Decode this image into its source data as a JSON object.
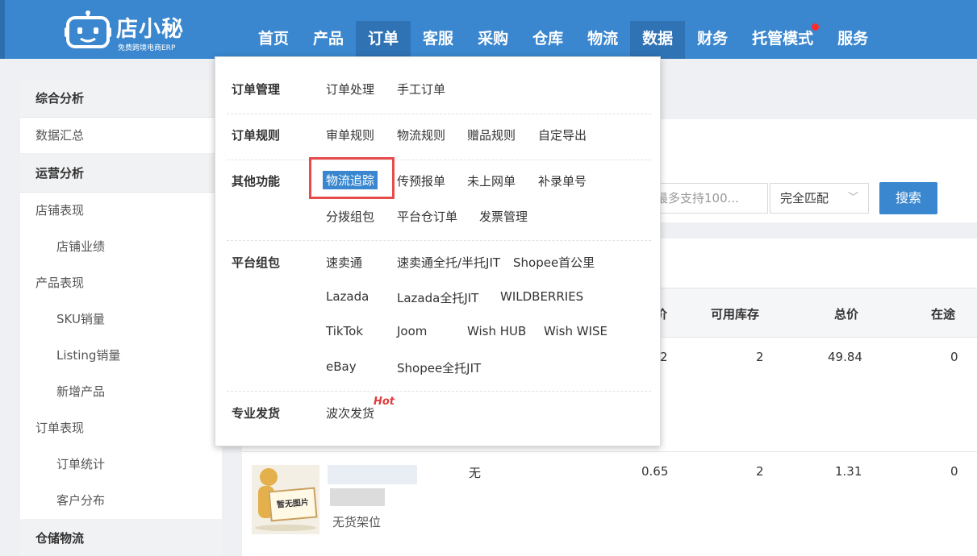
{
  "logo": {
    "name": "店小秘",
    "tagline": "免费跨境电商ERP"
  },
  "nav": [
    {
      "label": "首页"
    },
    {
      "label": "产品"
    },
    {
      "label": "订单",
      "state": "active"
    },
    {
      "label": "客服"
    },
    {
      "label": "采购"
    },
    {
      "label": "仓库"
    },
    {
      "label": "物流"
    },
    {
      "label": "数据",
      "state": "current"
    },
    {
      "label": "财务"
    },
    {
      "label": "托管模式",
      "has_notification_dot": true
    },
    {
      "label": "服务"
    }
  ],
  "sidebar": {
    "groups": [
      {
        "title": "综合分析",
        "items": [
          "数据汇总"
        ]
      },
      {
        "title": "运营分析",
        "items": [
          "店铺表现",
          "店铺业绩",
          "产品表现",
          "SKU销量",
          "Listing销量",
          "新增产品",
          "订单表现",
          "订单统计",
          "客户分布"
        ]
      },
      {
        "title": "仓储物流",
        "items": []
      }
    ]
  },
  "search": {
    "placeholder": "最多支持100...",
    "match_mode": "完全匹配",
    "button_label": "搜索"
  },
  "table": {
    "headers": [
      "价",
      "可用库存",
      "总价",
      "在途"
    ],
    "rows": [
      {
        "price": "2",
        "stock": "2",
        "total": "49.84",
        "transit": "0"
      },
      {
        "name": "无",
        "price": "0.65",
        "stock": "2",
        "total": "1.31",
        "transit": "0",
        "location": "无货架位",
        "image_text": "暂无图片"
      }
    ]
  },
  "dropdown": {
    "sections": [
      {
        "label": "订单管理",
        "links": [
          "订单处理",
          "手工订单"
        ]
      },
      {
        "label": "订单规则",
        "links": [
          "审单规则",
          "物流规则",
          "赠品规则",
          "自定导出"
        ]
      },
      {
        "label": "其他功能",
        "links": [
          "物流追踪",
          "传预报单",
          "未上网单",
          "补录单号",
          "分拨组包",
          "平台仓订单",
          "发票管理"
        ],
        "highlighted": "物流追踪"
      },
      {
        "label": "平台组包",
        "links": [
          "速卖通",
          "速卖通全托/半托JIT",
          "Shopee首公里",
          "Lazada",
          "Lazada全托JIT",
          "WILDBERRIES",
          "TikTok",
          "Joom",
          "Wish HUB",
          "Wish WISE",
          "eBay",
          "Shopee全托JIT"
        ]
      },
      {
        "label": "专业发货",
        "links": [
          "波次发货"
        ],
        "badge": "Hot"
      }
    ]
  },
  "colors": {
    "primary": "#3a87cf",
    "highlight_border": "#e84b4b",
    "hot": "#e23b3b"
  }
}
